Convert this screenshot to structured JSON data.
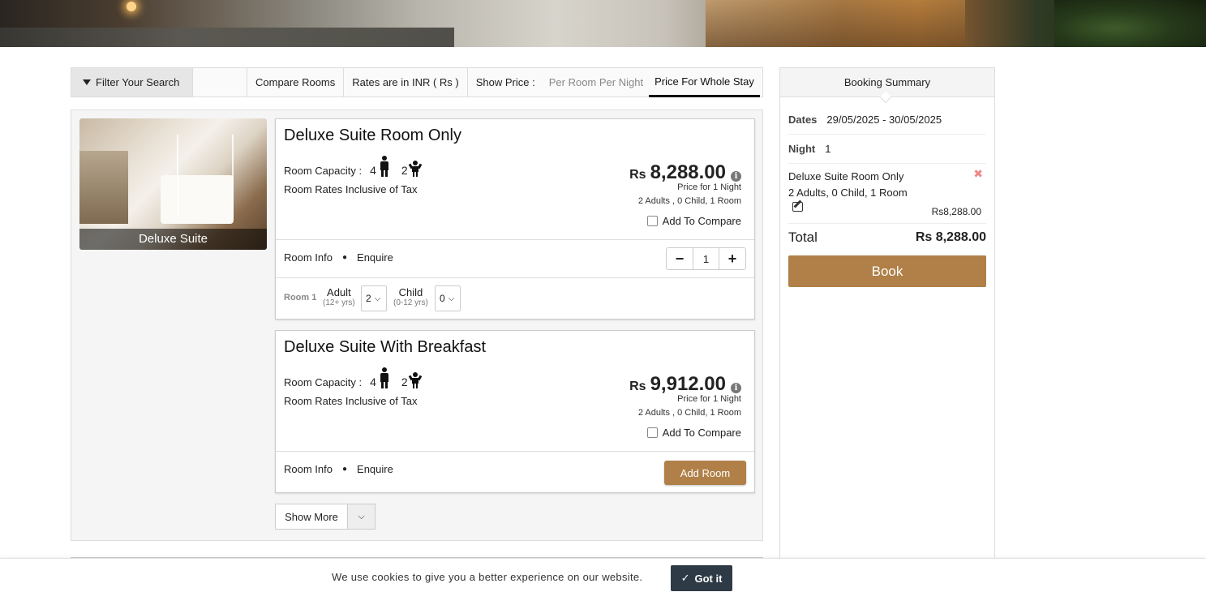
{
  "filter_bar": {
    "filter_label": "Filter Your Search",
    "compare_label": "Compare Rooms",
    "rates_label": "Rates are in INR ( Rs )",
    "show_price_label": "Show Price :",
    "price_options": [
      "Per Room Per Night",
      "Price For Whole Stay"
    ],
    "active_option": "Price For Whole Stay"
  },
  "room_type": {
    "caption": "Deluxe Suite"
  },
  "rooms": [
    {
      "title": "Deluxe Suite Room Only",
      "capacity_label": "Room Capacity :",
      "adults_capacity": "4",
      "children_capacity": "2",
      "tax_note": "Room Rates Inclusive of Tax",
      "currency": "Rs",
      "price": "8,288.00",
      "price_note": "Price for 1 Night",
      "occupancy": "2 Adults , 0 Child, 1 Room",
      "compare_label": "Add To Compare",
      "room_info_label": "Room Info",
      "enquire_label": "Enquire",
      "quantity": "1",
      "room_label": "Room 1",
      "adult_label": "Adult",
      "adult_sub": "(12+ yrs)",
      "adult_value": "2",
      "child_label": "Child",
      "child_sub": "(0-12 yrs)",
      "child_value": "0"
    },
    {
      "title": "Deluxe Suite With Breakfast",
      "capacity_label": "Room Capacity :",
      "adults_capacity": "4",
      "children_capacity": "2",
      "tax_note": "Room Rates Inclusive of Tax",
      "currency": "Rs",
      "price": "9,912.00",
      "price_note": "Price for 1 Night",
      "occupancy": "2 Adults , 0 Child, 1 Room",
      "compare_label": "Add To Compare",
      "room_info_label": "Room Info",
      "enquire_label": "Enquire",
      "add_room_label": "Add Room"
    }
  ],
  "show_more_label": "Show More",
  "summary": {
    "title": "Booking Summary",
    "dates_label": "Dates",
    "dates_value": "29/05/2025 - 30/05/2025",
    "night_label": "Night",
    "night_value": "1",
    "item_name": "Deluxe Suite Room Only",
    "item_occupancy": "2 Adults, 0 Child, 1 Room",
    "item_price": "Rs8,288.00",
    "total_label": "Total",
    "total_value": "Rs 8,288.00",
    "book_label": "Book"
  },
  "cookie": {
    "message": "We use cookies to give you a better experience on our website.",
    "button": "Got it"
  },
  "colors": {
    "accent": "#b08048",
    "cookie_button": "#2e3a46"
  }
}
